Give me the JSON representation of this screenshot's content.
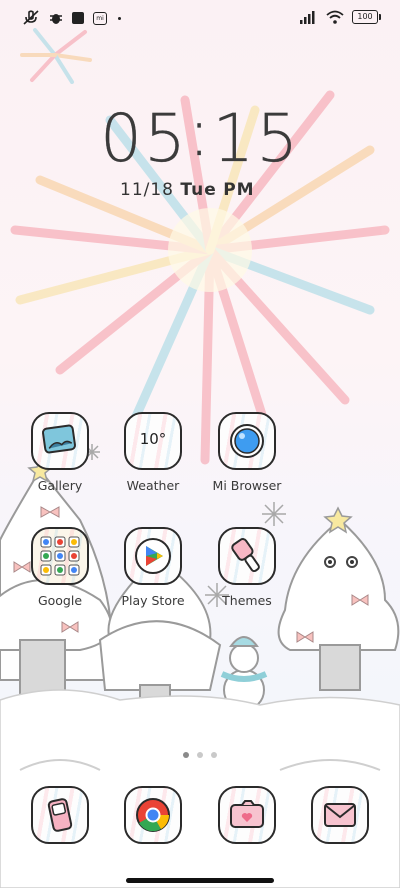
{
  "status_bar": {
    "icons_left": [
      "mic-off-icon",
      "bug-icon",
      "square-icon",
      "mi-icon",
      "dot-icon"
    ],
    "icons_right": [
      "signal-icon",
      "wifi-icon",
      "battery-icon"
    ],
    "battery": "100"
  },
  "clock": {
    "hours": "05",
    "minutes": "15"
  },
  "date": {
    "day": "11/18",
    "weekday": "Tue",
    "ampm": "PM"
  },
  "apps": [
    {
      "label": "Gallery",
      "icon": "gallery-icon"
    },
    {
      "label": "Weather",
      "icon": "weather-icon",
      "value": "10°"
    },
    {
      "label": "Mi Browser",
      "icon": "browser-icon"
    },
    {
      "label": "Google",
      "icon": "folder-icon"
    },
    {
      "label": "Play Store",
      "icon": "play-store-icon"
    },
    {
      "label": "Themes",
      "icon": "themes-icon"
    }
  ],
  "dock": [
    {
      "icon": "phone-icon"
    },
    {
      "icon": "chrome-icon"
    },
    {
      "icon": "camera-icon"
    },
    {
      "icon": "messages-icon"
    }
  ],
  "page_indicator": {
    "count": 3,
    "active": 1
  }
}
